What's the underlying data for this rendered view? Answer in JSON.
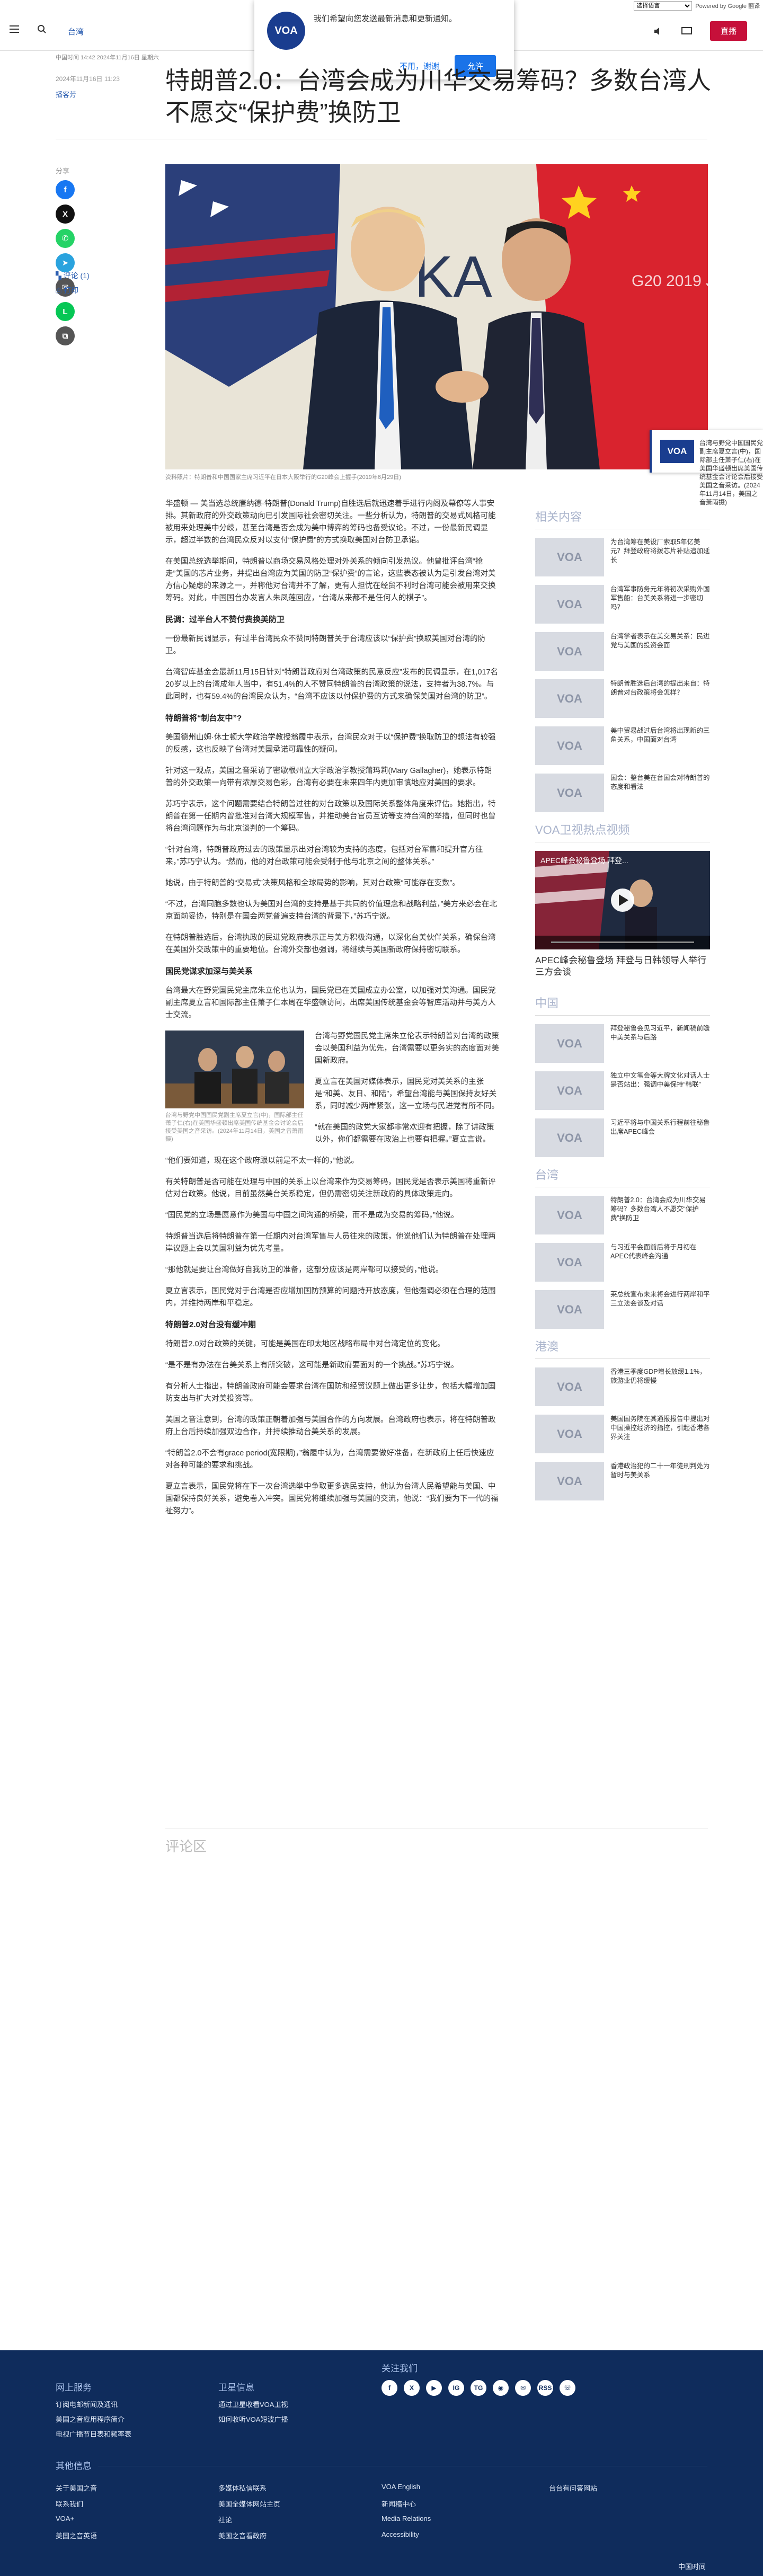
{
  "gtranslate": {
    "lang_option": "选择语言",
    "powered": "Powered by Google 翻译"
  },
  "header": {
    "section": "台湾",
    "live_label": "直播"
  },
  "notification": {
    "message": "我们希望向您发送最新消息和更新通知。",
    "decline": "不用，谢谢",
    "accept": "允许",
    "logo": "VOA"
  },
  "article": {
    "date_line": "中国时间 14:42 2024年11月16日 星期六",
    "updated": "2024年11月16日 11:23",
    "author": "播客芳",
    "title": "特朗普2.0：台湾会成为川华交易筹码？多数台湾人不愿交“保护费”换防卫",
    "hero_caption": "资料照片：特朗普和中国国家主席习近平在日本大阪举行的G20峰会上握手(2019年6月29日)",
    "hero_sign_left": "KA",
    "hero_sign_right": "G20 2019 JAPAN",
    "share_label": "分享",
    "comments_link": "评论 (1)",
    "print_link": "打印",
    "inline_caption": "台湾与野党中国国民党副主席夏立言(中)，国际部主任萧子仁(右)在美国华盛顿出席美国传统基金会讨论会后接受美国之音采访。(2024年11月14日，美国之音萧雨摄)",
    "paragraphs": [
      "华盛顿 — 美当选总统唐纳德·特朗普(Donald Trump)自胜选后就迅速着手进行内阁及幕僚等人事安排。其新政府的外交政策动向已引发国际社会密切关注。一些分析认为，特朗普的交易式风格可能被用来处理美中分歧，甚至台湾是否会成为美中博弈的筹码也备受议论。不过，一份最新民调显示，超过半数的台湾民众反对以支付“保护费”的方式换取美国对台防卫承诺。",
      "在美国总统选举期间，特朗普以商场交易风格处理对外关系的倾向引发热议。他曾批评台湾“抢走”美国的芯片业务，并提出台湾应为美国的防卫“保护费”的言论，这些表态被认为是引发台湾对美方信心疑虑的来源之一，并称他对台湾并不了解，更有人担忧在经贸不利时台湾可能会被用来交换筹码。对此，中国国台办发言人朱凤莲回应，“台湾从来都不是任何人的棋子”。",
      "一份最新民调显示，有过半台湾民众不赞同特朗普关于台湾应该以“保护费”换取美国对台湾的防卫。",
      "台湾智库基金会最新11月15日针对“特朗普政府对台湾政策的民意反应”发布的民调显示，在1,017名20岁以上的台湾成年人当中，有51.4%的人不赞同特朗普的台湾政策的说法，支持者为38.7%。与此同时，也有59.4%的台湾民众认为，“台湾不应该以付保护费的方式来确保美国对台湾的防卫”。",
      "美国德州山姆·休士顿大学政治学教授翁履中表示，台湾民众对于以“保护费”换取防卫的想法有较强的反感，这也反映了台湾对美国承诺可靠性的疑问。",
      "针对这一观点，美国之音采访了密歇根州立大学政治学教授蒲玛莉(Mary Gallagher)，她表示特朗普的外交政策一向带有浓厚交易色彩，台湾有必要在未来四年内更加审慎地应对美国的要求。",
      "苏巧宁表示，这个问题需要结合特朗普过往的对台政策以及国际关系整体角度来评估。她指出，特朗普在第一任期内曾批准对台湾大规模军售，并推动美台官员互访等支持台湾的举措，但同时也曾将台湾问题作为与北京谈判的一个筹码。",
      "“针对台湾，特朗普政府过去的政策显示出对台湾较为支持的态度，包括对台军售和提升官方往来，”苏巧宁认为。“然而，他的对台政策可能会受制于他与北京之间的整体关系。”",
      "她说，由于特朗普的“交易式”决策风格和全球局势的影响，其对台政策“可能存在变数”。",
      "“不过，台湾同胞多数也认为美国对台湾的支持是基于共同的价值理念和战略利益，”美方来必会在北京面前妥协，特别是在国会两党普遍支持台湾的背景下，”苏巧宁说。",
      "在特朗普胜选后，台湾执政的民进党政府表示正与美方积极沟通，以深化台美伙伴关系，确保台湾在美国外交政策中的重要地位。台湾外交部也强调，将继续与美国新政府保持密切联系。",
      "台湾最大在野党国民党主席朱立伦也认为，国民党已在美国成立办公室，以加强对美沟通。国民党副主席夏立言和国际部主任萧子仁本周在华盛顿访问，出席美国传统基金会等智库活动并与美方人士交流。",
      "台湾与野党国民党主席朱立伦表示特朗普对台湾的政策会以美国利益为优先，台湾需要以更务实的态度面对美国新政府。",
      "夏立言在美国对媒体表示，国民党对美关系的主张是“和美、友日、和陆”，希望台湾能与美国保持友好关系，同时减少两岸紧张，这一立场与民进党有所不同。",
      "“就在美国的政党大家都非常欢迎有把握，除了讲政策以外，你们都需要在政治上也要有把握。”夏立言说。",
      "“他们要知道，现在这个政府跟以前是不太一样的，”他说。",
      "有关特朗普是否可能在处理与中国的关系上以台湾来作为交易筹码，国民党是否表示美国将重新评估对台政策。他说，目前虽然美台关系稳定，但仍需密切关注新政府的具体政策走向。",
      "“国民党的立场是愿意作为美国与中国之间沟通的桥梁，而不是成为交易的筹码，”他说。",
      "特朗普当选后将特朗普在第一任期内对台湾军售与人员往来的政策，他说他们认为特朗普在处理两岸议题上会以美国利益为优先考量。",
      "“那他就是要让台湾做好自我防卫的准备，这部分应该是两岸都可以接受的，”他说。",
      "夏立言表示，国民党对于台湾是否应增加国防预算的问题持开放态度，但他强调必须在合理的范围内，并维持两岸和平稳定。",
      "特朗普2.0对台政策的关键，可能是美国在印太地区战略布局中对台湾定位的变化。",
      "“是不是有办法在台美关系上有所突破，这可能是新政府要面对的一个挑战。”苏巧宁说。",
      "有分析人士指出，特朗普政府可能会要求台湾在国防和经贸议题上做出更多让步，包括大幅增加国防支出与扩大对美投资等。",
      "美国之音注意到，台湾的政策正朝着加强与美国合作的方向发展。台湾政府也表示，将在特朗普政府上台后持续加强双边合作，并持续推动台美关系的发展。",
      "“特朗普2.0不会有grace period(宽限期)，”翁履中认为，台湾需要做好准备，在新政府上任后快速应对各种可能的要求和挑战。",
      "夏立言表示，国民党将在下一次台湾选举中争取更多选民支持，他认为台湾人民希望能与美国、中国都保持良好关系，避免卷入冲突。国民党将继续加强与美国的交流，他说：“我们要为下一代的福祉努力”。"
    ],
    "subheads": [
      "民调：过半台人不赞付费换美防卫",
      "特朗普将“制台友中”?",
      "国民党谋求加深与美关系",
      "特朗普2.0对台没有缓冲期"
    ]
  },
  "sidebar": {
    "related_title": "相关内容",
    "related": [
      "为台湾筹在美设厂索取5年亿美元？拜登政府将拨芯片补贴追加延长",
      "台湾军事防务元年将初次采购外国军售船：台美关系将进一步密切吗？",
      "台湾学者表示在美交易关系：民进党与美国的投资会面",
      "特朗普胜选后台湾的提出来自：特朗普对台政策将会怎样？",
      "美中贸易战过后台湾将出现新的三角关系，中国面对台湾",
      "国会：鉴台美在台国会对特朗普的态度和看法"
    ],
    "video_title": "VOA卫视热点视频",
    "video_caption": "APEC峰会秘鲁登场 拜登与日韩领导人举行三方会谈",
    "video_overlay": "APEC峰会秘鲁登场 拜登...",
    "china_title": "中国",
    "china": [
      "拜登秘鲁会见习近平，新闻稿前瞻中美关系与后路",
      "独立中文笔会等大牌文化对话人士是否站出：强调中美保持“韩联”",
      "习近平将与中国关系行程前往秘鲁出席APEC峰会"
    ],
    "taiwan_title": "台湾",
    "taiwan": [
      "特朗普2.0：台湾会成为川华交易筹码？多数台湾人不愿交“保护费”换防卫",
      "与习近平会面前后将于月初在APEC代表峰会沟通",
      "莱总统宣布未来将会进行两岸和平三立法会谈及对话"
    ],
    "hk_title": "港澳",
    "hk": [
      "香港三季度GDP增长放缓1.1%，旅游业仍将缓慢",
      "美国国务院在其通报报告中提出对中国操控经济的指控，引起香港各界关注",
      "香港政治犯的二十一年徒刑判处为暂时与美关系"
    ]
  },
  "footer": {
    "col1_title": "网上服务",
    "col1": [
      "订阅电邮新闻及通讯",
      "美国之音应用程序简介",
      "电视广播节目表和频率表"
    ],
    "col2_title": "卫星信息",
    "col2": [
      "通过卫星收看VOA卫视",
      "如何收听VOA短波广播"
    ],
    "col3_title": "关注我们",
    "social": [
      "f",
      "X",
      "▶",
      "IG",
      "TG",
      "◉",
      "✉",
      "RSS",
      "☏"
    ],
    "other_title": "其他信息",
    "links": [
      "关于美国之音",
      "联系我们",
      "VOA+",
      "美国之音英语",
      "多媒体私信联系",
      "美国全媒体网站主页",
      "社论",
      "美国之音看政府",
      "VOA English",
      "新闻稿中心",
      "Media Relations",
      "Accessibility",
      "台台有问答网站"
    ],
    "bottom": "中国时间"
  }
}
